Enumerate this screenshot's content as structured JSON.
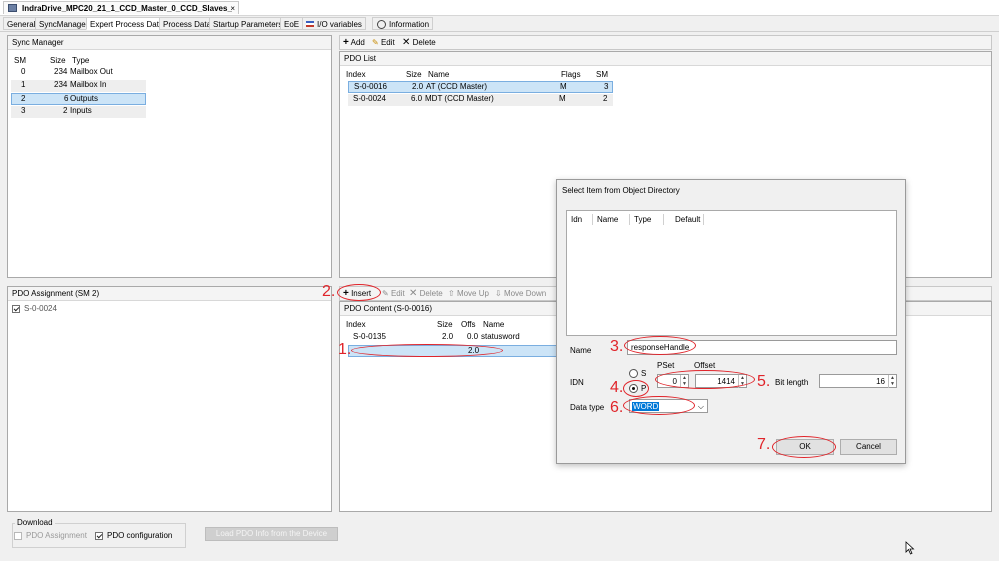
{
  "window": {
    "doc_tab": "IndraDrive_MPC20_21_1_CCD_Master_0_CCD_Slaves_"
  },
  "tabs": [
    "General",
    "SyncManager",
    "Expert Process Data",
    "Process Data",
    "Startup Parameters",
    "EoE",
    "I/O variables",
    "Information"
  ],
  "sync_manager": {
    "title": "Sync Manager",
    "headers": [
      "SM",
      "Size",
      "Type"
    ],
    "rows": [
      [
        "0",
        "234",
        "Mailbox Out"
      ],
      [
        "1",
        "234",
        "Mailbox In"
      ],
      [
        "2",
        "6",
        "Outputs"
      ],
      [
        "3",
        "2",
        "Inputs"
      ]
    ]
  },
  "pdo_toolbar": {
    "add": "Add",
    "edit": "Edit",
    "delete": "Delete"
  },
  "pdo_list": {
    "title": "PDO List",
    "headers": [
      "Index",
      "Size",
      "Name",
      "Flags",
      "SM"
    ],
    "rows": [
      [
        "S-0-0016",
        "2.0",
        "AT (CCD Master)",
        "M",
        "3"
      ],
      [
        "S-0-0024",
        "6.0",
        "MDT (CCD Master)",
        "M",
        "2"
      ]
    ]
  },
  "pdo_assignment": {
    "title": "PDO Assignment (SM 2)",
    "item": "S-0-0024"
  },
  "content_toolbar": {
    "insert": "Insert",
    "edit": "Edit",
    "delete": "Delete",
    "move_up": "Move Up",
    "move_down": "Move Down"
  },
  "pdo_content": {
    "title": "PDO Content (S-0-0016)",
    "headers": [
      "Index",
      "Size",
      "Offs",
      "Name"
    ],
    "rows": [
      [
        "S-0-0135",
        "2.0",
        "0.0",
        "statusword"
      ],
      [
        "",
        "",
        "2.0",
        ""
      ]
    ]
  },
  "download": {
    "title": "Download",
    "pdo_assignment": "PDO Assignment",
    "pdo_configuration": "PDO configuration",
    "load_button": "Load PDO Info from the Device"
  },
  "dialog": {
    "title": "Select Item from Object Directory",
    "list_headers": [
      "Idn",
      "Name",
      "Type",
      "Default"
    ],
    "name_label": "Name",
    "name_value": "responseHandle",
    "pset_label": "PSet",
    "offset_label": "Offset",
    "idn_label": "IDN",
    "radio_s": "S",
    "radio_p": "P",
    "pset_value": "0",
    "offset_value": "1414",
    "bit_length_label": "Bit length",
    "bit_length_value": "16",
    "data_type_label": "Data type",
    "data_type_value": "WORD",
    "ok": "OK",
    "cancel": "Cancel"
  },
  "annotations": [
    "1.",
    "2.",
    "3.",
    "4.",
    "5.",
    "6.",
    "7."
  ],
  "colors": {
    "annotation": "#e0242a",
    "selection": "#cce4f7"
  }
}
